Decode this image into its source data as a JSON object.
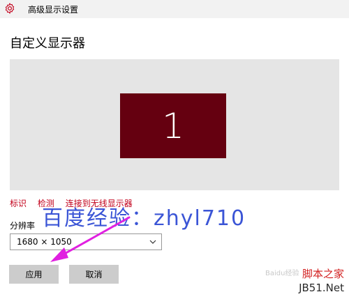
{
  "window": {
    "title": "高级显示设置",
    "icon": "gear-icon"
  },
  "page": {
    "title": "自定义显示器"
  },
  "display": {
    "monitor_number": "1",
    "monitor_color": "#650010"
  },
  "links": {
    "identify": "标识",
    "detect": "检测",
    "connect_wireless": "连接到无线显示器"
  },
  "resolution": {
    "label": "分辨率",
    "selected": "1680 × 1050"
  },
  "buttons": {
    "apply": "应用",
    "cancel": "取消"
  },
  "watermark": {
    "text": "百度经验：zhyl710",
    "corner_top": "脚本之家",
    "corner_bottom": "JB51.Net",
    "faint": "Baidu经验"
  },
  "colors": {
    "accent_link": "#c2001b",
    "watermark_blue": "#3b55d6",
    "arrow": "#e020e0"
  }
}
